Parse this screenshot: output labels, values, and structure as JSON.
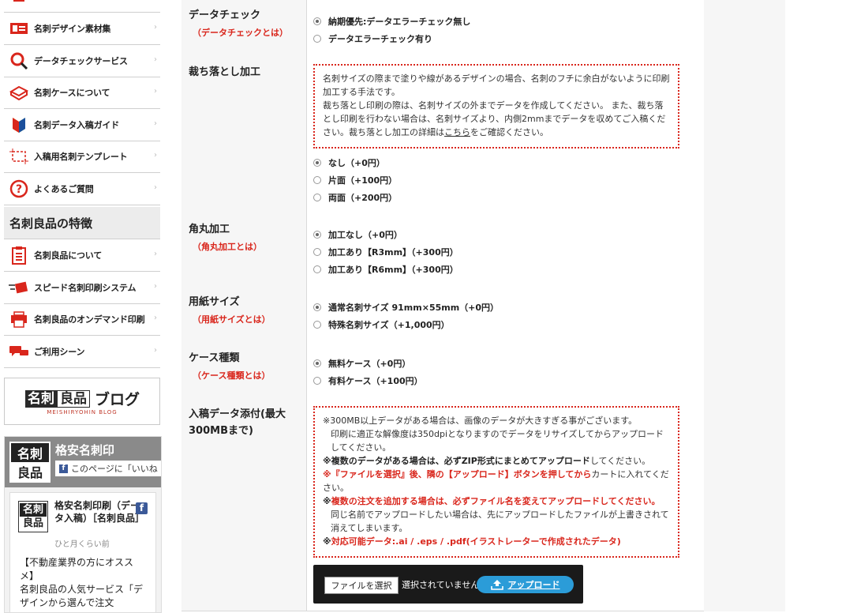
{
  "sidebar": {
    "menu1": [
      {
        "label": "名刺デザイン素材集",
        "icon": "card-icon"
      },
      {
        "label": "データチェックサービス",
        "icon": "magnifier-icon"
      },
      {
        "label": "名刺ケースについて",
        "icon": "case-icon"
      },
      {
        "label": "名刺データ入稿ガイド",
        "icon": "beginner-mark-icon"
      },
      {
        "label": "入稿用名刺テンプレート",
        "icon": "template-icon"
      },
      {
        "label": "よくあるご質問",
        "icon": "question-icon"
      }
    ],
    "section_title": "名刺良品の特徴",
    "menu2": [
      {
        "label": "名刺良品について",
        "icon": "clipboard-icon"
      },
      {
        "label": "スピード名刺印刷システム",
        "icon": "speed-cards-icon"
      },
      {
        "label": "名刺良品のオンデマンド印刷",
        "icon": "printer-icon"
      },
      {
        "label": "ご利用シーン",
        "icon": "speech-bubbles-icon"
      }
    ],
    "blog": {
      "box1": "名刺",
      "box2": "良品",
      "word": "ブログ",
      "sub": "MEISHIRYOHIN BLOG"
    },
    "facebook": {
      "cover_logo_top": "名刺",
      "cover_logo_bottom": "良品",
      "cover_title": "格安名刺印",
      "cover_like": "このページに「いいね",
      "post_logo_top": "名刺",
      "post_logo_bottom": "良品",
      "post_name": "格安名刺印刷（データ入稿）［名刺良品］",
      "post_time": "ひと月くらい前",
      "post_body": "【不動産業界の方にオススメ】\n名刺良品の人気サービス「デザインから選んで注文"
    }
  },
  "form": {
    "data_check": {
      "title": "データチェック",
      "help": "（データチェックとは）",
      "options": [
        {
          "label": "納期優先:データエラーチェック無し",
          "checked": true
        },
        {
          "label": "データエラーチェック有り",
          "checked": false
        }
      ]
    },
    "bleed": {
      "title": "裁ち落とし加工",
      "notice_line1": "名刺サイズの際まで塗りや線があるデザインの場合、名刺のフチに余白がないように印刷加工する手法です。",
      "notice_line2": "裁ち落とし印刷の際は、名刺サイズの外までデータを作成してください。 また、裁ち落とし印刷を行わない場合は、名刺サイズより、内側2mmまでデータを収めてご入稿ください。裁ち落とし加工の詳細は",
      "notice_link": "こちら",
      "notice_tail": "をご確認ください。",
      "options": [
        {
          "label": "なし（+0円）",
          "checked": true
        },
        {
          "label": "片面（+100円）",
          "checked": false
        },
        {
          "label": "両面（+200円）",
          "checked": false
        }
      ]
    },
    "corner": {
      "title": "角丸加工",
      "help": "（角丸加工とは）",
      "options": [
        {
          "label": "加工なし（+0円）",
          "checked": true
        },
        {
          "label": "加工あり【R3mm】（+300円）",
          "checked": false
        },
        {
          "label": "加工あり【R6mm】（+300円）",
          "checked": false
        }
      ]
    },
    "paper_size": {
      "title": "用紙サイズ",
      "help": "（用紙サイズとは）",
      "options": [
        {
          "label": "通常名刺サイズ 91mm×55mm（+0円）",
          "checked": true
        },
        {
          "label": "特殊名刺サイズ（+1,000円）",
          "checked": false
        }
      ]
    },
    "case_type": {
      "title": "ケース種類",
      "help": "（ケース種類とは）",
      "options": [
        {
          "label": "無料ケース（+0円）",
          "checked": true
        },
        {
          "label": "有料ケース（+100円）",
          "checked": false
        }
      ]
    },
    "attachment": {
      "title": "入稿データ添付(最大300MBまで)",
      "n1": "※300MB以上データがある場合は、画像のデータが大きすぎる事がございます。",
      "n1b": "印刷に適正な解像度は350dpiとなりますのでデータをリサイズしてからアップロードしてください。",
      "n2a": "※",
      "n2b": "複数のデータがある場合は、必ずZIP形式にまとめてアップロード",
      "n2c": "してください。",
      "n3a": "※",
      "n3b": "『ファイルを選択』後、隣の【アップロード】ボタンを押してから",
      "n3c": "カートに入れてください。",
      "n4a": "※",
      "n4b": "複数の注文を追加する場合は、必ずファイル名を変えてアップロードしてください。",
      "n4c": "同じ名前でアップロードしたい場合は、先にアップロードしたファイルが上書きされて消えてしまいます。",
      "n5a": "※",
      "n5b": "対応可能データ:.ai / .eps / .pdf(イラストレーターで作成されたデータ)",
      "file_button": "ファイルを選択",
      "file_status": "選択されていません",
      "upload_button": "アップロード"
    }
  },
  "colors": {
    "accent_red": "#d9261c",
    "upload_blue": "#2b9cd8"
  }
}
